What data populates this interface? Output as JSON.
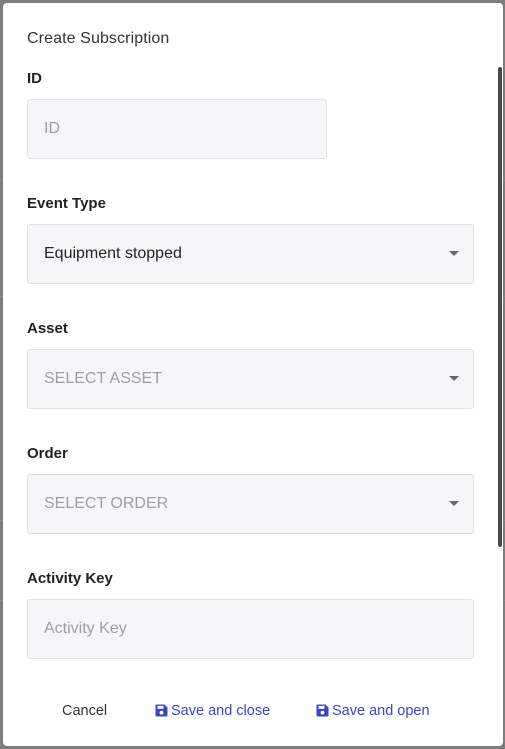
{
  "dialog": {
    "title": "Create Subscription"
  },
  "form": {
    "id": {
      "label": "ID",
      "placeholder": "ID"
    },
    "event_type": {
      "label": "Event Type",
      "value": "Equipment stopped"
    },
    "asset": {
      "label": "Asset",
      "placeholder": "SELECT ASSET"
    },
    "order": {
      "label": "Order",
      "placeholder": "SELECT ORDER"
    },
    "activity_key": {
      "label": "Activity Key",
      "placeholder": "Activity Key"
    }
  },
  "actions": {
    "cancel_label": "Cancel",
    "save_close_label": "Save and close",
    "save_open_label": "Save and open",
    "save_icon": "floppy-disk-icon"
  },
  "colors": {
    "accent": "#3a47c4",
    "field_bg": "#f5f6f8",
    "field_border": "#dfe1e5",
    "placeholder": "#9aa0a6"
  }
}
